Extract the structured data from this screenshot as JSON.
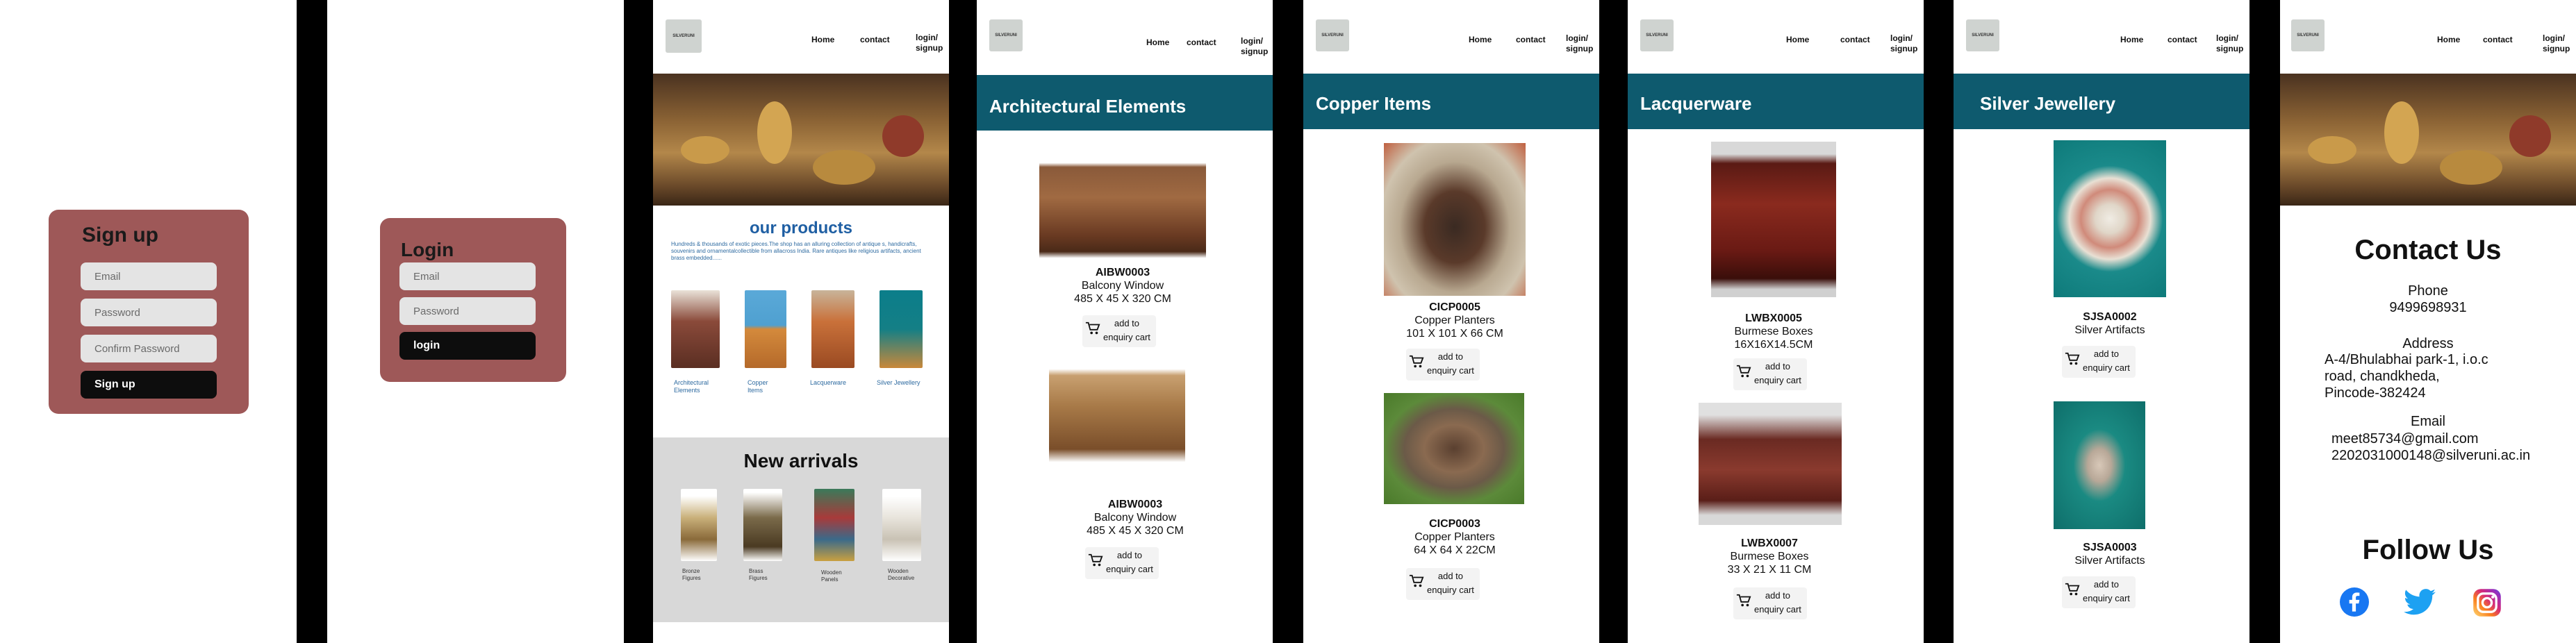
{
  "signup": {
    "title": "Sign up",
    "email_placeholder": "Email",
    "password_placeholder": "Password",
    "confirm_placeholder": "Confirm Password",
    "button": "Sign  up"
  },
  "login": {
    "title": "Login",
    "email_placeholder": "Email",
    "password_placeholder": "Password",
    "button": "login"
  },
  "nav": {
    "home": "Home",
    "contact": "contact",
    "login_line1": "login/",
    "login_line2": "signup",
    "logo_text": "SILVERUNI"
  },
  "home": {
    "products_title": "our products",
    "products_text": "Hundreds & thousands of exotic pieces.The shop has an alluring collection of antique s, handicrafts, souvenirs and ornamentalcollectible from allacross India. Rare antiques like religious artifacts, ancient brass embedded......",
    "categories": [
      {
        "label_1": "Architectural",
        "label_2": "Elements"
      },
      {
        "label_1": "Copper",
        "label_2": "Items"
      },
      {
        "label_1": "Lacquerware",
        "label_2": ""
      },
      {
        "label_1": "Silver Jewellery",
        "label_2": ""
      }
    ],
    "arrivals_title": "New arrivals",
    "arrivals": [
      {
        "label_1": "Bronze",
        "label_2": "Figures"
      },
      {
        "label_1": "Brass",
        "label_2": "Figures"
      },
      {
        "label_1": "Wooden",
        "label_2": "Panels"
      },
      {
        "label_1": "Wooden",
        "label_2": "Decorative"
      }
    ]
  },
  "cart_line1": "add to",
  "cart_line2": "enquiry cart",
  "architectural": {
    "title": "Architectural Elements",
    "items": [
      {
        "code": "AIBW0003",
        "name": "Balcony Window",
        "size": "485 X 45 X 320 CM"
      },
      {
        "code": "AIBW0003",
        "name": "Balcony Window",
        "size": "485 X 45 X 320 CM"
      }
    ]
  },
  "copper": {
    "title": "Copper Items",
    "items": [
      {
        "code": "CICP0005",
        "name": "Copper Planters",
        "size": "101 X 101 X 66 CM"
      },
      {
        "code": "CICP0003",
        "name": "Copper Planters",
        "size": "64 X 64 X 22CM"
      }
    ]
  },
  "lacquer": {
    "title": "Lacquerware",
    "items": [
      {
        "code": "LWBX0005",
        "name": "Burmese Boxes",
        "size": "16X16X14.5CM"
      },
      {
        "code": "LWBX0007",
        "name": "Burmese Boxes",
        "size": "33 X 21 X 11 CM"
      }
    ]
  },
  "silver": {
    "title": "Silver Jewellery",
    "items": [
      {
        "code": "SJSA0002",
        "name": "Silver Artifacts"
      },
      {
        "code": "SJSA0003",
        "name": "Silver Artifacts"
      }
    ]
  },
  "contact": {
    "title": "Contact Us",
    "phone_label": "Phone",
    "phone": "9499698931",
    "address_label": "Address",
    "address_1": "A-4/Bhulabhai park-1, i.o.c",
    "address_2": "road, chandkheda,",
    "address_3": "Pincode-382424",
    "email_label": "Email",
    "email_1": "meet85734@gmail.com",
    "email_2": "2202031000148@silveruni.ac.in",
    "follow_title": "Follow Us",
    "social": [
      "facebook-icon",
      "twitter-icon",
      "instagram-icon"
    ]
  },
  "colors": {
    "card": "#9e5858",
    "banner": "#0e5a6e",
    "link_blue": "#2d6aa0",
    "facebook": "#1877f2",
    "twitter": "#1da1f2"
  }
}
